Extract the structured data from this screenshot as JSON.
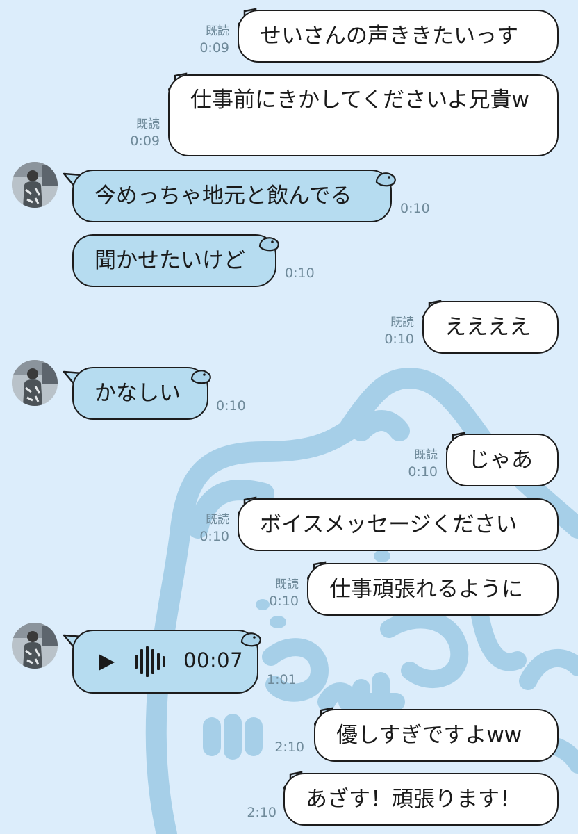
{
  "chat": {
    "messages": [
      {
        "id": "m1",
        "direction": "out",
        "text": "せいさんの声ききたいっす",
        "read": "既読",
        "time": "0:09"
      },
      {
        "id": "m2",
        "direction": "out",
        "text": "仕事前にきかしてくださいよ兄貴w",
        "read": "既読",
        "time": "0:09"
      },
      {
        "id": "m3",
        "direction": "in",
        "text": "今めっちゃ地元と飲んでる",
        "time": "0:10"
      },
      {
        "id": "m4",
        "direction": "in",
        "text": "聞かせたいけど",
        "time": "0:10"
      },
      {
        "id": "m5",
        "direction": "out",
        "text": "ええええ",
        "read": "既読",
        "time": "0:10"
      },
      {
        "id": "m6",
        "direction": "in",
        "text": "かなしい",
        "time": "0:10"
      },
      {
        "id": "m7",
        "direction": "out",
        "text": "じゃあ",
        "read": "既読",
        "time": "0:10"
      },
      {
        "id": "m8",
        "direction": "out",
        "text": "ボイスメッセージください",
        "read": "既読",
        "time": "0:10"
      },
      {
        "id": "m9",
        "direction": "out",
        "text": "仕事頑張れるように",
        "read": "既読",
        "time": "0:10"
      },
      {
        "id": "m10",
        "direction": "in",
        "type": "voice",
        "duration": "00:07",
        "time": "1:01"
      },
      {
        "id": "m11",
        "direction": "out",
        "text": "優しすぎですよww",
        "time": "2:10"
      },
      {
        "id": "m12",
        "direction": "out",
        "text": "あざす！頑張ります！",
        "time": "2:10"
      }
    ]
  },
  "colors": {
    "background": "#dcedfb",
    "outgoing_bubble": "#ffffff",
    "incoming_bubble": "#b6dcf0",
    "meta_text": "#6f8a9a",
    "background_art": "#9fcbe6"
  },
  "icons": {
    "outgoing_bubble_deco": "music-note-icon",
    "incoming_bubble_deco": "bird-icon",
    "voice_play": "play-icon",
    "voice_wave": "waveform-icon"
  }
}
